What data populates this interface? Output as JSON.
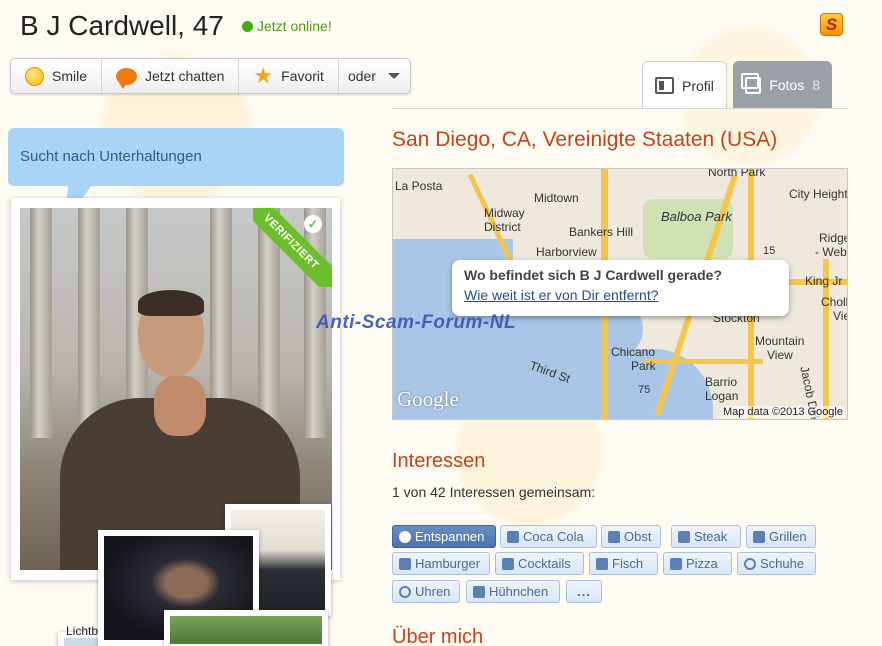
{
  "profile": {
    "name": "B J Cardwell, 47",
    "status": "Jetzt online!",
    "status_color": "#3fae13",
    "speech_bubble": "Sucht nach Unterhaltungen",
    "verified_label": "VERIFIZIERT",
    "thumb_label": "Lichtbilde"
  },
  "actions": [
    {
      "label": "Smile",
      "icon": "smile-icon"
    },
    {
      "label": "Jetzt chatten",
      "icon": "chat-icon"
    },
    {
      "label": "Favorit",
      "icon": "star-icon"
    },
    {
      "label": "oder",
      "icon": "chevron-down-icon"
    }
  ],
  "tabs": {
    "profil": {
      "label": "Profil",
      "icon": "profile-icon"
    },
    "fotos": {
      "label": "Fotos",
      "count": "8",
      "icon": "photos-icon"
    }
  },
  "location": "San Diego, CA, Vereinigte Staaten (USA)",
  "map": {
    "popup_question": "Wo befindet sich B J Cardwell gerade?",
    "popup_link": "Wie weit ist er von Dir entfernt?",
    "attribution": "Map data ©2013 Google",
    "google_logo": "Google",
    "labels": {
      "north_park": "North Park",
      "la_posta": "La Posta",
      "midtown": "Midtown",
      "midway": "Midway",
      "district": "District",
      "city_height": "City Height",
      "balboa": "Balboa Park",
      "bankers": "Bankers Hill",
      "harborview": "Harborview",
      "r15": "15",
      "ridgeview": "Ridge",
      "webster": "- Webs",
      "kingjr": "King Jr",
      "chollas": "Choll",
      "view": "Vie",
      "stockton": "Stockton",
      "mountain": "Mountain",
      "mview": "View",
      "chicano": "Chicano",
      "park": "Park",
      "third": "Third St",
      "r75": "75",
      "barrio": "Barrio",
      "logan": "Logan",
      "jacob": "Jacob Dekem"
    }
  },
  "watermark": "Anti-Scam-Forum-NL",
  "interests": {
    "title": "Interessen",
    "common": "1 von 42 Interessen gemeinsam:",
    "tags": [
      "Entspannen",
      "Coca Cola",
      "Obst",
      "Steak",
      "Grillen",
      "Hamburger",
      "Cocktails",
      "Fisch",
      "Pizza",
      "Schuhe",
      "Uhren",
      "Hühnchen",
      "..."
    ]
  },
  "about": {
    "title": "Über mich"
  },
  "colors": {
    "accent": "#c5431a",
    "bubble": "#a8d4f8",
    "verified": "#6bbf2b"
  }
}
